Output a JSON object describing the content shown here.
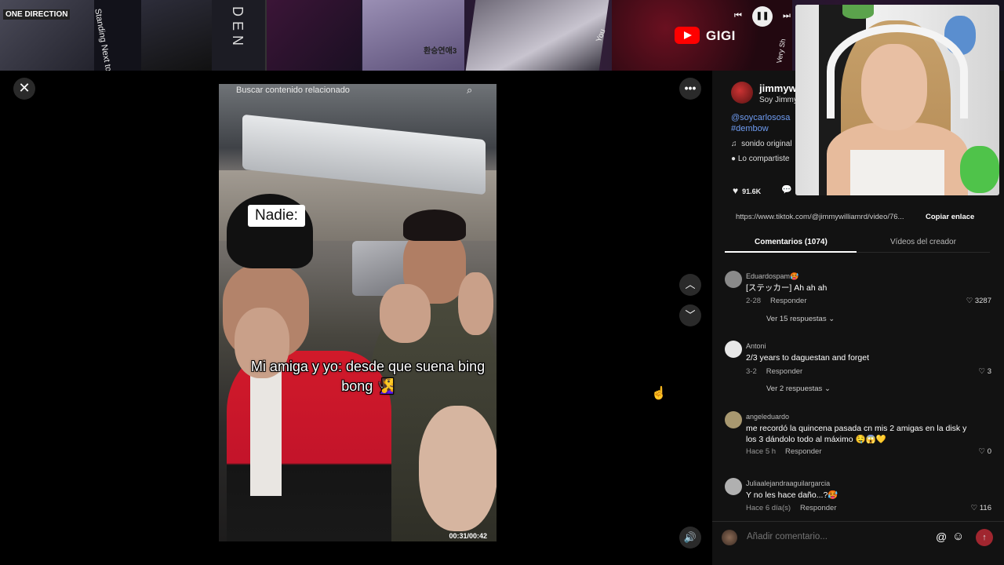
{
  "stream": {
    "channel": "GIGI",
    "banner_texts": [
      "ONE DIRECTION",
      "Standing Next to You",
      "DEN",
      "환승연애3",
      "You",
      "Very Sh"
    ]
  },
  "video": {
    "search_placeholder": "Buscar contenido relacionado",
    "overlay_label": "Nadie:",
    "caption": "Mi amiga y yo: desde que suena bing bong 🧏‍♀️",
    "timecode": "00:31/00:42"
  },
  "panel": {
    "author_name": "jimmyw",
    "author_sub": "Soy Jimmy",
    "desc_mention": "@soycarlososa",
    "desc_hashtag": "#dembow",
    "music": "sonido original",
    "shared": "Lo compartiste",
    "likes": "91.6K",
    "url": "https://www.tiktok.com/@jimmywilliamrd/video/76...",
    "copy_link": "Copiar enlace",
    "tab_comments": "Comentarios (1074)",
    "tab_creator": "Vídeos del creador",
    "comments": [
      {
        "user": "Eduardospam🥵",
        "text": "[ステッカー] Ah ah ah",
        "date": "2-28",
        "reply": "Responder",
        "likes": "3287",
        "more": "Ver 15 respuestas",
        "avatar_color": "#8a8a8a"
      },
      {
        "user": "Antoni",
        "text": "2/3 years to daguestan and forget",
        "date": "3-2",
        "reply": "Responder",
        "likes": "3",
        "more": "Ver 2 respuestas",
        "avatar_color": "#e8e8e8"
      },
      {
        "user": "angeleduardo",
        "text": "me recordó la quincena pasada cn mis 2 amigas en la disk y los 3 dándolo todo al máximo 🤤😱💛",
        "date": "Hace 5 h",
        "reply": "Responder",
        "likes": "0",
        "avatar_color": "#a89870"
      },
      {
        "user": "Juliaalejandraaguilargarcia",
        "text": "Y no les hace daño...?🥵",
        "date": "Hace 6 día(s)",
        "reply": "Responder",
        "likes": "116",
        "avatar_color": "#b0b0b0"
      }
    ],
    "comment_placeholder": "Añadir comentario..."
  },
  "icons": {
    "close": "close-icon",
    "more": "more-icon",
    "up": "chevron-up-icon",
    "down": "chevron-down-icon",
    "volume": "volume-icon",
    "search": "search-icon",
    "heart": "heart-icon",
    "comment": "comment-icon",
    "music": "music-note-icon",
    "at": "at-icon",
    "emoji": "emoji-icon",
    "send": "send-icon"
  },
  "colors": {
    "accent_link": "#6f9cf2",
    "send_button": "#a0262f",
    "youtube_red": "#ff0000"
  }
}
